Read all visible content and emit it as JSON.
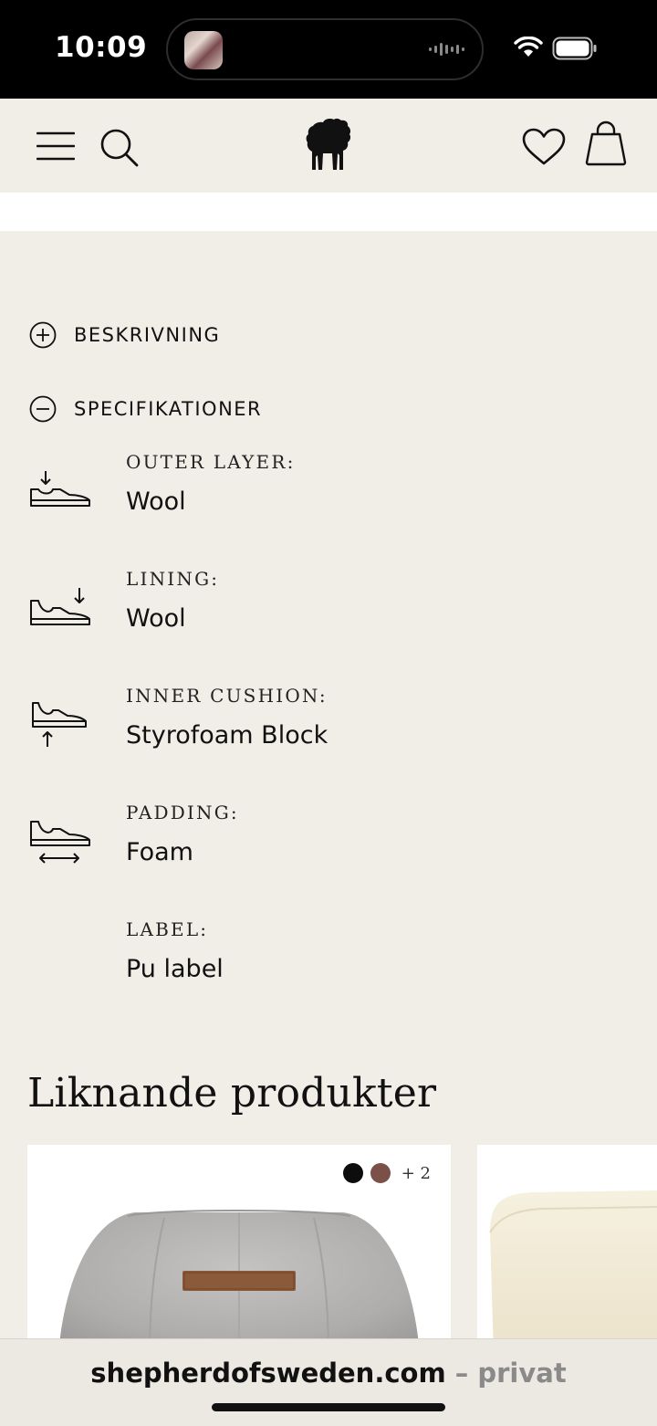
{
  "status_bar": {
    "time": "10:09"
  },
  "header": {
    "menu_icon": "hamburger-menu-icon",
    "search_icon": "search-icon",
    "logo_icon": "sheep-logo-icon",
    "wishlist_icon": "heart-icon",
    "cart_icon": "shopping-bag-icon"
  },
  "accordion": [
    {
      "label": "BESKRIVNING",
      "state": "collapsed",
      "icon": "plus-circle-icon"
    },
    {
      "label": "SPECIFIKATIONER",
      "state": "expanded",
      "icon": "minus-circle-icon"
    }
  ],
  "specs": [
    {
      "key": "OUTER LAYER:",
      "value": "Wool",
      "icon": "shoe-outer-layer-icon"
    },
    {
      "key": "LINING:",
      "value": "Wool",
      "icon": "shoe-lining-icon"
    },
    {
      "key": "INNER CUSHION:",
      "value": "Styrofoam Block",
      "icon": "shoe-inner-cushion-icon"
    },
    {
      "key": "PADDING:",
      "value": "Foam",
      "icon": "shoe-padding-icon"
    },
    {
      "key": "LABEL:",
      "value": "Pu label",
      "icon": ""
    }
  ],
  "related": {
    "title": "Liknande produkter",
    "cards": [
      {
        "swatch_colors": [
          "#0d0d0d",
          "#7a5048"
        ],
        "more_colors": "+ 2",
        "image": "grey-wool-pouf-image"
      },
      {
        "image": "cream-sheepskin-pouf-image"
      }
    ]
  },
  "browser": {
    "domain": "shepherdofsweden.com",
    "separator": " – ",
    "mode": "privat"
  },
  "colors": {
    "page_background": "#f1ede7",
    "header_background": "#f1ede7",
    "accent_text": "#111111"
  }
}
